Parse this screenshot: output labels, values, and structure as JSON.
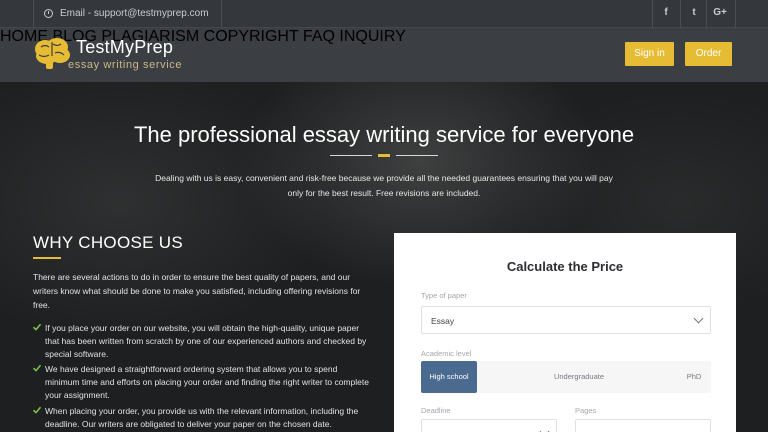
{
  "topbar": {
    "email": "Email - support@testmyprep.com",
    "social": [
      "f",
      "t",
      "G+"
    ]
  },
  "brand": {
    "name": "TestMyPrep",
    "tagline": "essay writing service",
    "accent": "#e7bc35"
  },
  "nav": {
    "items": [
      "HOME",
      "BLOG",
      "PLAGIARISM",
      "COPYRIGHT",
      "FAQ",
      "INQUIRY"
    ],
    "sign_in": "Sign in",
    "order": "Order"
  },
  "hero": {
    "title": "The professional essay writing service for everyone",
    "text": "Dealing with us is easy, convenient and risk-free because we provide all the needed guarantees ensuring that you will pay only for the best result. Free revisions are included."
  },
  "why": {
    "title": "WHY CHOOSE US",
    "intro": "There are several actions to do in order to ensure the best quality of papers, and our writers know what should be done to make you satisfied, including offering revisions for free.",
    "items": [
      "If you place your order on our website, you will obtain the high-quality, unique paper that has been written from scratch by one of our experienced authors and checked by special software.",
      "We have designed a straightforward ordering system that allows you to spend minimum time and efforts on placing your order and finding the right writer to complete your assignment.",
      "When placing your order, you provide us with the relevant information, including the deadline. Our writers are obligated to deliver your paper on the chosen date."
    ]
  },
  "calc": {
    "title": "Calculate the Price",
    "type_label": "Type of paper",
    "type_value": "Essay",
    "level_label": "Academic level",
    "levels": [
      "High school",
      "Undergraduate",
      "PhD"
    ],
    "active_level": "High school",
    "deadline_label": "Deadline",
    "pages_label": "Pages"
  }
}
